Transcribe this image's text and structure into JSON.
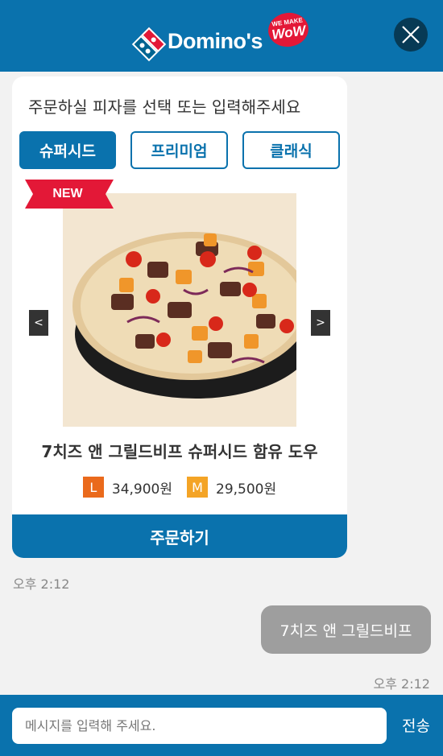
{
  "header": {
    "brand_name": "Domino's",
    "badge_top": "WE MAKE",
    "badge_main": "WoW",
    "brand_colors": {
      "blue": "#0a72ad",
      "red": "#e31837",
      "dark_blue": "#006491"
    },
    "close_icon": "close-icon"
  },
  "card": {
    "prompt": "주문하실 피자를 선택 또는 입력해주세요",
    "tabs": [
      {
        "label": "슈퍼시드",
        "active": true
      },
      {
        "label": "프리미엄",
        "active": false
      },
      {
        "label": "클래식",
        "active": false
      }
    ],
    "new_badge": "NEW",
    "prev_arrow": "<",
    "next_arrow": ">",
    "pizza_name": "7치즈 앤 그릴드비프 슈퍼시드 함유 도우",
    "prices": [
      {
        "size": "L",
        "price": "34,900원",
        "color": "#ea6a1c"
      },
      {
        "size": "M",
        "price": "29,500원",
        "color": "#f4a426"
      }
    ],
    "order_button": "주문하기"
  },
  "chat": {
    "bot_time": "오후 2:12",
    "user_message": "7치즈 앤 그릴드비프",
    "user_time": "오후 2:12"
  },
  "footer": {
    "input_placeholder": "메시지를 입력해 주세요.",
    "input_value": "",
    "send_label": "전송"
  }
}
